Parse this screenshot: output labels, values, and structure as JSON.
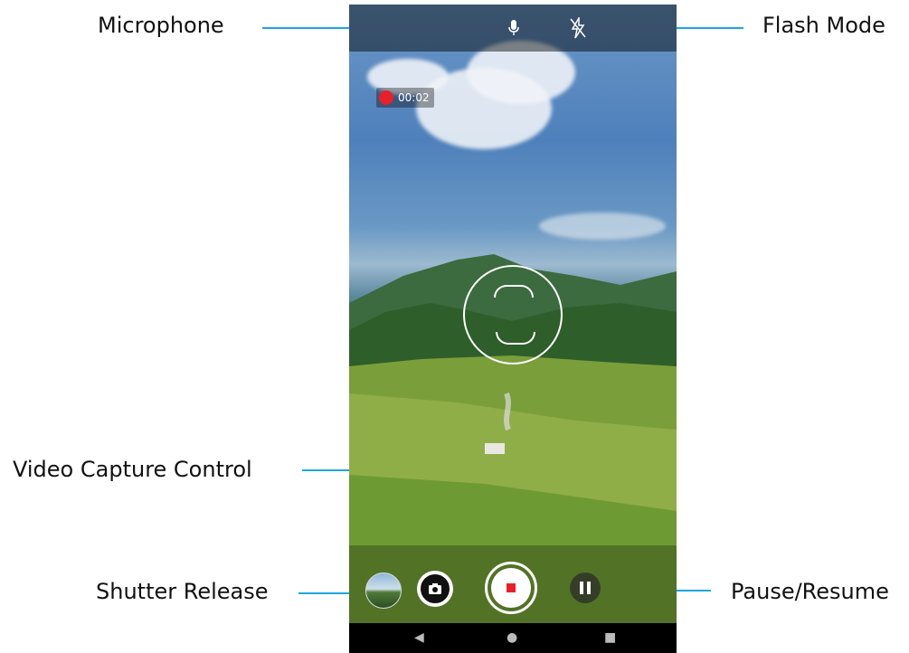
{
  "labels": {
    "microphone": "Microphone",
    "flash_mode": "Flash Mode",
    "video_capture_control": "Video Capture Control",
    "shutter_release": "Shutter Release",
    "pause_resume": "Pause/Resume"
  },
  "recording": {
    "time": "00:02",
    "indicator_color": "#e8202a"
  },
  "icons": {
    "microphone": "microphone-icon",
    "flash": "flash-off-icon",
    "shutter": "camera-icon",
    "record": "stop-icon",
    "pause": "pause-icon",
    "nav_back": "back-triangle-icon",
    "nav_home": "home-circle-icon",
    "nav_recents": "recents-square-icon"
  },
  "colors": {
    "callout_line": "#1aa7de",
    "record_red": "#e8202a"
  }
}
